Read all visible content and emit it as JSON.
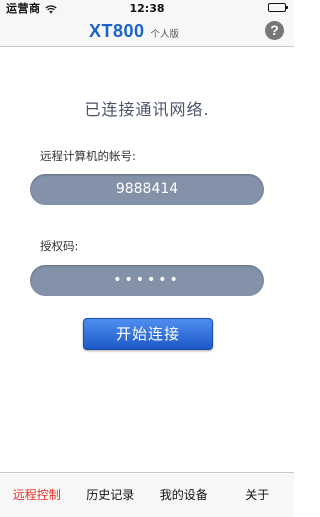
{
  "status_bar": {
    "carrier": "运营商",
    "time": "12:38",
    "icons": [
      "wifi-icon",
      "battery-icon"
    ]
  },
  "nav": {
    "brand": "XT800",
    "edition": "个人版",
    "help_label": "?",
    "help_icon": "question-mark-circle-icon"
  },
  "main": {
    "status_message": "已连接通讯网络.",
    "account_label": "远程计算机的帐号:",
    "account_value": "9888414",
    "password_label": "授权码:",
    "password_value": "••••••",
    "connect_label": "开始连接"
  },
  "tabs": [
    {
      "label": "远程控制",
      "active": true
    },
    {
      "label": "历史记录",
      "active": false
    },
    {
      "label": "我的设备",
      "active": false
    },
    {
      "label": "关于",
      "active": false
    }
  ],
  "colors": {
    "brand": "#1a63c9",
    "field_bg": "#8392a9",
    "button": "#1c58c7",
    "active_tab": "#e4322b"
  }
}
